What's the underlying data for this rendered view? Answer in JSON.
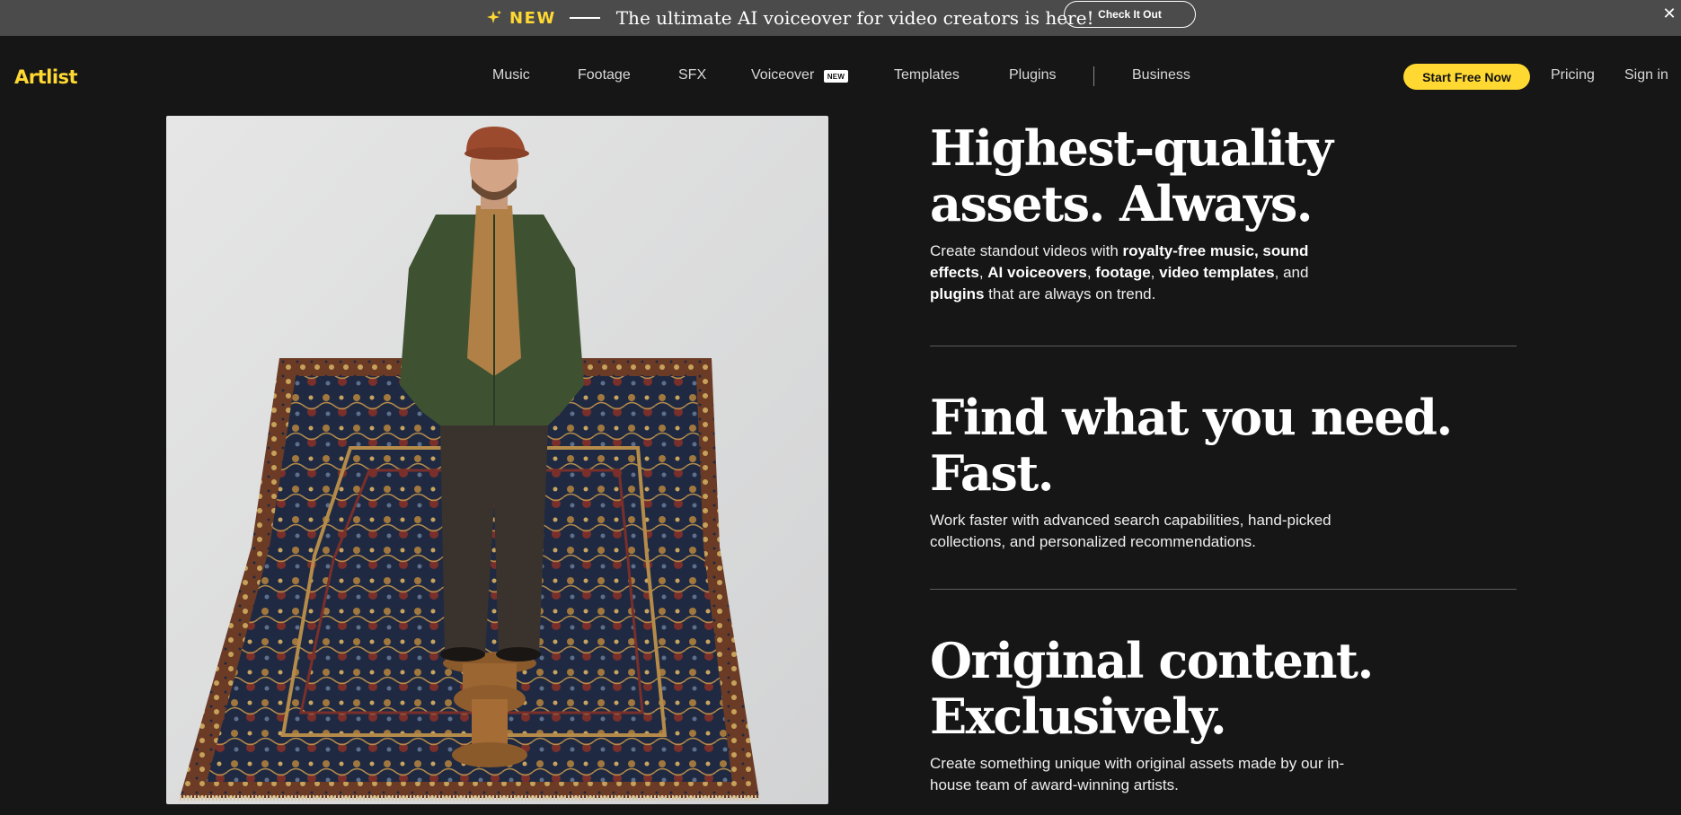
{
  "announcement": {
    "icon": "sparkle-icon",
    "tag": "NEW",
    "text": "The ultimate AI voiceover for video creators is here!",
    "cta": "Check It Out",
    "close": "✕"
  },
  "nav": {
    "logo": "Artlist",
    "items": [
      "Music",
      "Footage",
      "SFX",
      "Voiceover",
      "Templates",
      "Plugins",
      "Business"
    ],
    "voiceover_badge": "NEW",
    "start_button": "Start Free Now",
    "pricing": "Pricing",
    "sign_in": "Sign in"
  },
  "colors": {
    "accent": "#ffd832",
    "background": "#161616",
    "announcement_bg": "#4b4b4b"
  },
  "features": [
    {
      "title_line1": "Highest-quality",
      "title_line2": "assets. Always.",
      "desc_parts": [
        "Create standout videos with ",
        "royalty-free music, sound effects",
        ", ",
        "AI voiceovers",
        ", ",
        "footage",
        ", ",
        "video templates",
        ", and ",
        "plugins",
        " that are always on trend."
      ]
    },
    {
      "title_line1": "Find what you need.",
      "title_line2": "Fast.",
      "desc": "Work faster with advanced search capabilities, hand-picked collections, and personalized recommendations."
    },
    {
      "title_line1": "Original content.",
      "title_line2": "Exclusively.",
      "desc": "Create something unique with original assets made by our in-house team of award-winning artists."
    }
  ]
}
